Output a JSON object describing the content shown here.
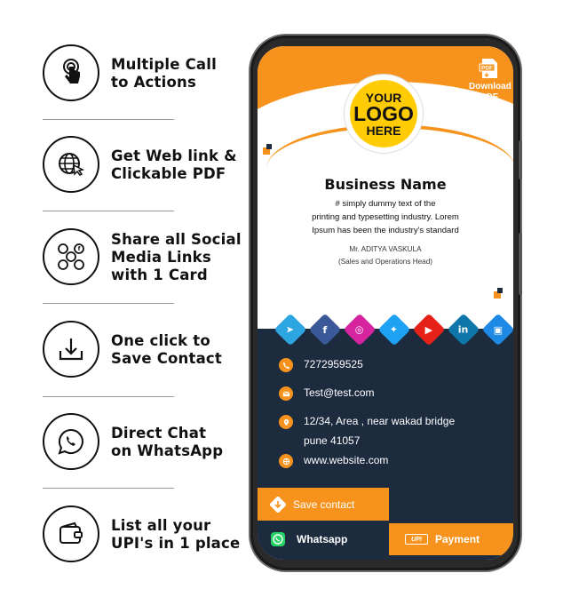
{
  "features": [
    {
      "icon": "tap-hand-icon",
      "label": "Multiple Call\nto Actions"
    },
    {
      "icon": "globe-cursor-icon",
      "label": "Get Web link &\nClickable PDF"
    },
    {
      "icon": "social-network-icon",
      "label": "Share all Social\nMedia Links\nwith 1 Card"
    },
    {
      "icon": "download-icon",
      "label": "One click to\nSave Contact"
    },
    {
      "icon": "whatsapp-icon",
      "label": "Direct Chat\non WhatsApp"
    },
    {
      "icon": "wallet-icon",
      "label": "List all your\nUPI's in 1 place"
    }
  ],
  "card": {
    "logo": {
      "line1": "YOUR",
      "line2": "LOGO",
      "line3": "HERE"
    },
    "pdf": {
      "badge": "PDF",
      "label": "Download\nPDF"
    },
    "business_name": "Business Name",
    "description": "# simply dummy text of the\nprinting and typesetting industry. Lorem\nIpsum has been the industry's standard",
    "person_name": "Mr. ADITYA VASKULA",
    "person_role": "(Sales and Operations Head)",
    "social": [
      {
        "icon": "telegram-icon",
        "color": "#2ca5e0"
      },
      {
        "icon": "facebook-icon",
        "color": "#3b5998"
      },
      {
        "icon": "instagram-icon",
        "color": "#d6249f"
      },
      {
        "icon": "twitter-icon",
        "color": "#1da1f2"
      },
      {
        "icon": "youtube-icon",
        "color": "#e62117"
      },
      {
        "icon": "linkedin-icon",
        "color": "#0e76a8"
      },
      {
        "icon": "contact-book-icon",
        "color": "#1e88e5"
      }
    ],
    "contacts": {
      "phone": "7272959525",
      "email": "Test@test.com",
      "address": "12/34, Area , near wakad bridge\npune 41057",
      "website": "www.website.com"
    },
    "buttons": {
      "save": "Save contact",
      "whatsapp": "Whatsapp",
      "payment": "Payment",
      "upi": "UPI"
    },
    "colors": {
      "primary": "#f7931d",
      "dark": "#1d2b3f",
      "logo": "#ffcb05"
    }
  }
}
